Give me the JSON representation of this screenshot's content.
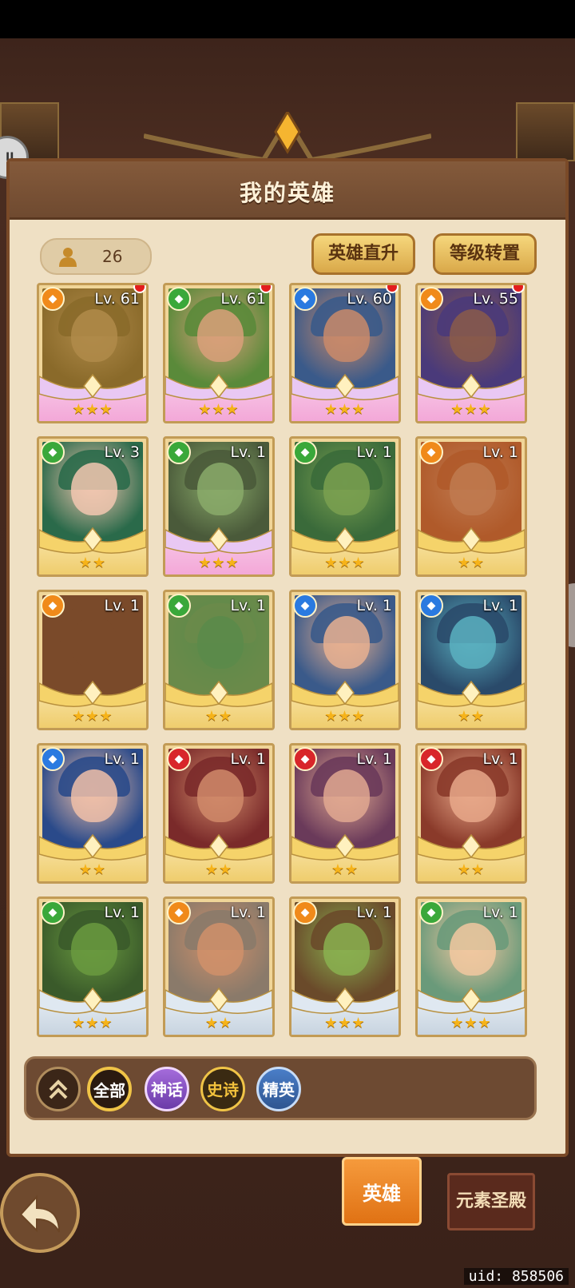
{
  "header": {
    "title": "我的英雄"
  },
  "hero_count": "26",
  "buttons": {
    "rise": "英雄直升",
    "transfer": "等级转置"
  },
  "heroes": [
    {
      "lv": "Lv. 61",
      "stars": 3,
      "elem": "orange",
      "frame": "pink",
      "dot": true,
      "tone": "#8a6a2a",
      "face": "#b08b4a"
    },
    {
      "lv": "Lv. 61",
      "stars": 3,
      "elem": "green",
      "frame": "pink",
      "dot": true,
      "tone": "#5a8a3a",
      "face": "#d9a07a"
    },
    {
      "lv": "Lv. 60",
      "stars": 3,
      "elem": "blue",
      "frame": "pink",
      "dot": true,
      "tone": "#3a5a8a",
      "face": "#c98a6a"
    },
    {
      "lv": "Lv. 55",
      "stars": 3,
      "elem": "orange",
      "frame": "pink",
      "dot": true,
      "tone": "#4a3a7a",
      "face": "#8a5a4a"
    },
    {
      "lv": "Lv. 3",
      "stars": 2,
      "elem": "green",
      "frame": "gold",
      "dot": false,
      "tone": "#2a6a4a",
      "face": "#f2c7b0"
    },
    {
      "lv": "Lv. 1",
      "stars": 3,
      "elem": "green",
      "frame": "pink",
      "dot": false,
      "tone": "#4a5a3a",
      "face": "#8aaa6a"
    },
    {
      "lv": "Lv. 1",
      "stars": 3,
      "elem": "green",
      "frame": "gold",
      "dot": false,
      "tone": "#3a6a3a",
      "face": "#7aa050"
    },
    {
      "lv": "Lv. 1",
      "stars": 2,
      "elem": "orange",
      "frame": "gold",
      "dot": false,
      "tone": "#b05a2a",
      "face": "#c07a50"
    },
    {
      "lv": "Lv. 1",
      "stars": 3,
      "elem": "orange",
      "frame": "gold",
      "dot": false,
      "tone": "#7a4a2a",
      "face": "#7a4a2a"
    },
    {
      "lv": "Lv. 1",
      "stars": 2,
      "elem": "green",
      "frame": "gold",
      "dot": false,
      "tone": "#6a8a4a",
      "face": "#5a8a4a"
    },
    {
      "lv": "Lv. 1",
      "stars": 3,
      "elem": "blue",
      "frame": "gold",
      "dot": false,
      "tone": "#3a5a8a",
      "face": "#e8b090"
    },
    {
      "lv": "Lv. 1",
      "stars": 2,
      "elem": "blue",
      "frame": "gold",
      "dot": false,
      "tone": "#2a4a6a",
      "face": "#5ab0c0"
    },
    {
      "lv": "Lv. 1",
      "stars": 2,
      "elem": "blue",
      "frame": "gold",
      "dot": false,
      "tone": "#2a4a8a",
      "face": "#f0c0a8"
    },
    {
      "lv": "Lv. 1",
      "stars": 2,
      "elem": "red",
      "frame": "gold",
      "dot": false,
      "tone": "#7a2a2a",
      "face": "#d08a6a"
    },
    {
      "lv": "Lv. 1",
      "stars": 2,
      "elem": "red",
      "frame": "gold",
      "dot": false,
      "tone": "#6a3a5a",
      "face": "#e0a890"
    },
    {
      "lv": "Lv. 1",
      "stars": 2,
      "elem": "red",
      "frame": "gold",
      "dot": false,
      "tone": "#8a3a2a",
      "face": "#e8a88a"
    },
    {
      "lv": "Lv. 1",
      "stars": 3,
      "elem": "green",
      "frame": "silver",
      "dot": false,
      "tone": "#3a5a2a",
      "face": "#6a9a40"
    },
    {
      "lv": "Lv. 1",
      "stars": 2,
      "elem": "orange",
      "frame": "silver",
      "dot": false,
      "tone": "#8a7a6a",
      "face": "#d0906a"
    },
    {
      "lv": "Lv. 1",
      "stars": 3,
      "elem": "orange",
      "frame": "silver",
      "dot": false,
      "tone": "#6a4a2a",
      "face": "#8ab050"
    },
    {
      "lv": "Lv. 1",
      "stars": 3,
      "elem": "green",
      "frame": "silver",
      "dot": false,
      "tone": "#6a9a7a",
      "face": "#f2c8a0"
    }
  ],
  "element_colors": {
    "orange": "#f08a1a",
    "green": "#3aa83a",
    "blue": "#2a7ae0",
    "red": "#d8262a"
  },
  "filters": {
    "all": "全部",
    "myth": "神话",
    "epic": "史诗",
    "elite": "精英"
  },
  "tabs": {
    "hero": "英雄",
    "temple": "元素圣殿"
  },
  "uid": "uid: 858506"
}
